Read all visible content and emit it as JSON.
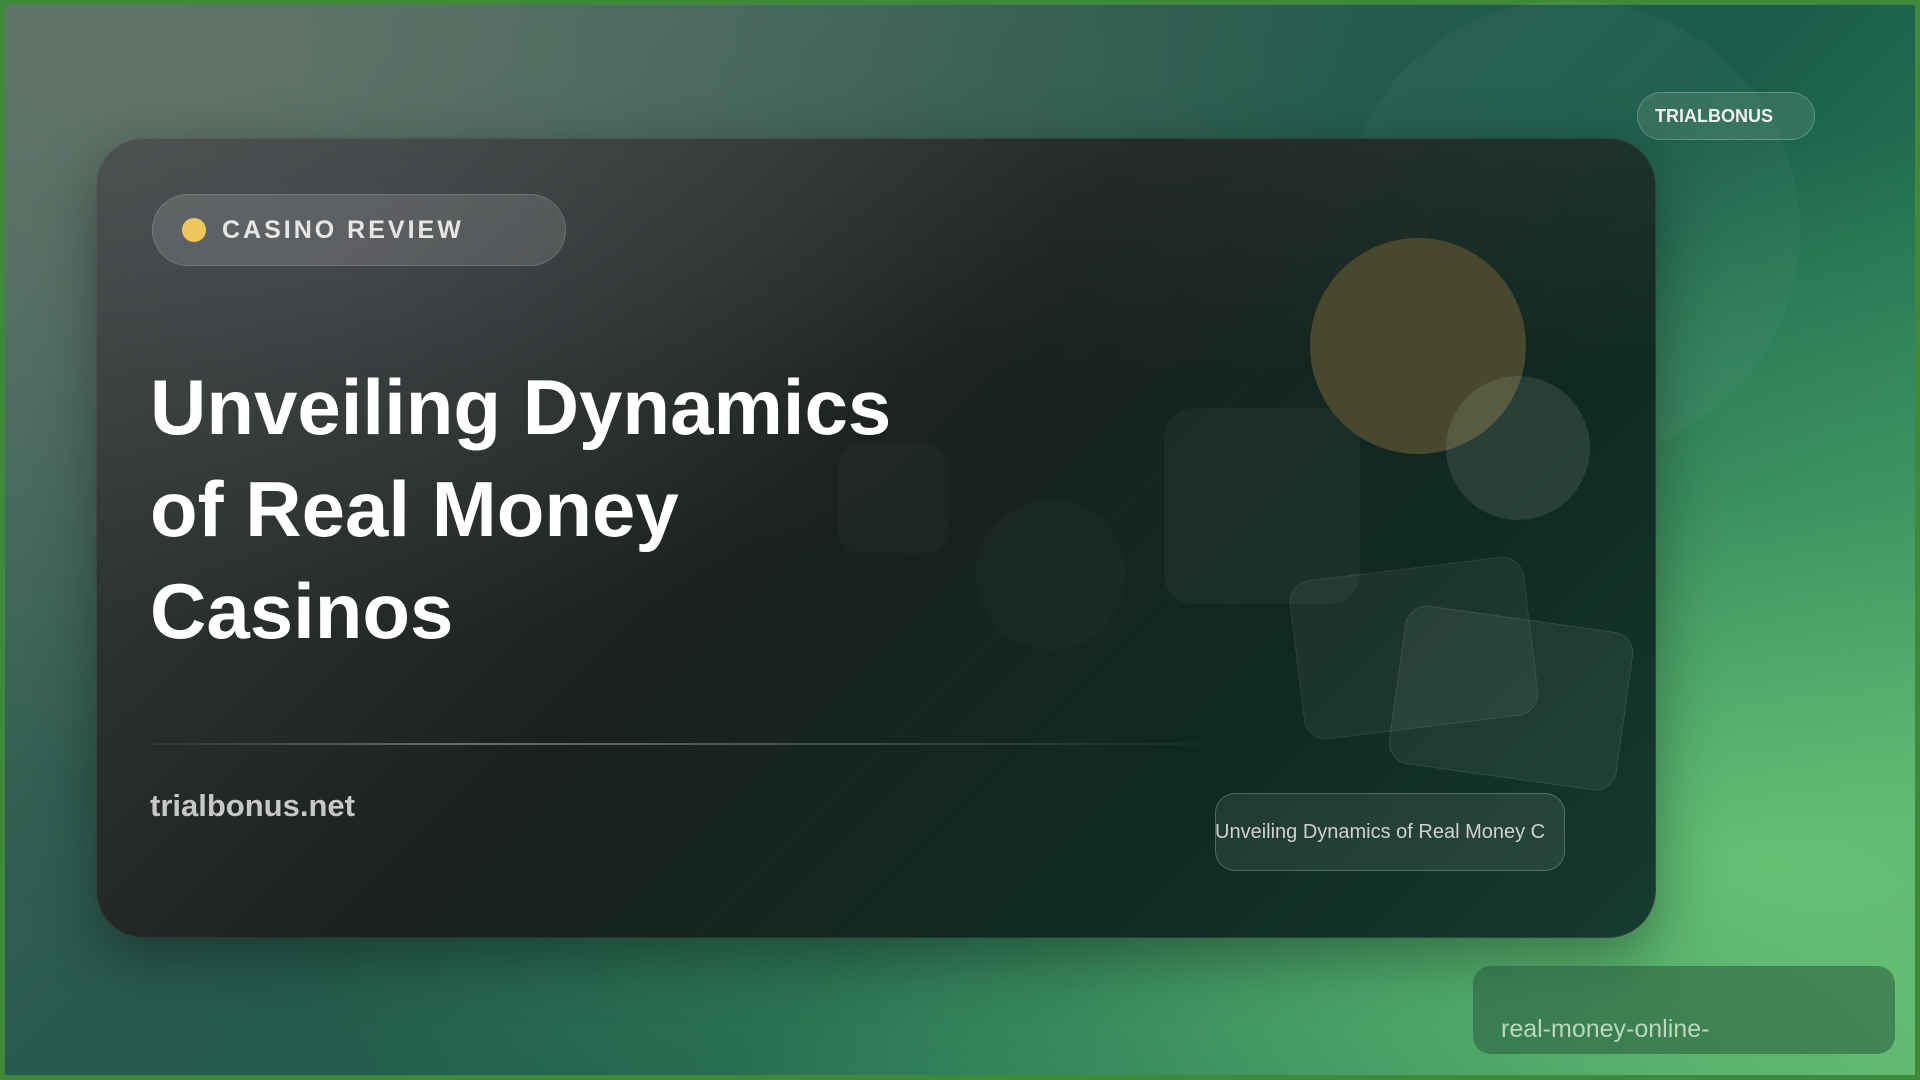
{
  "badge": {
    "label": "CASINO REVIEW",
    "dot_color": "#f0c75a"
  },
  "title": {
    "line1": "Unveiling Dynamics",
    "line2": "of Real Money",
    "line3": "Casinos"
  },
  "site": "trialbonus.net",
  "caption": "Unveiling Dynamics of Real Money C",
  "brand": "TRIALBONUS",
  "slug": "real-money-online-",
  "colors": {
    "accent_gold": "#f0c75a",
    "card_dark": "#1a201e",
    "bg_green": "#2f8a5c"
  }
}
